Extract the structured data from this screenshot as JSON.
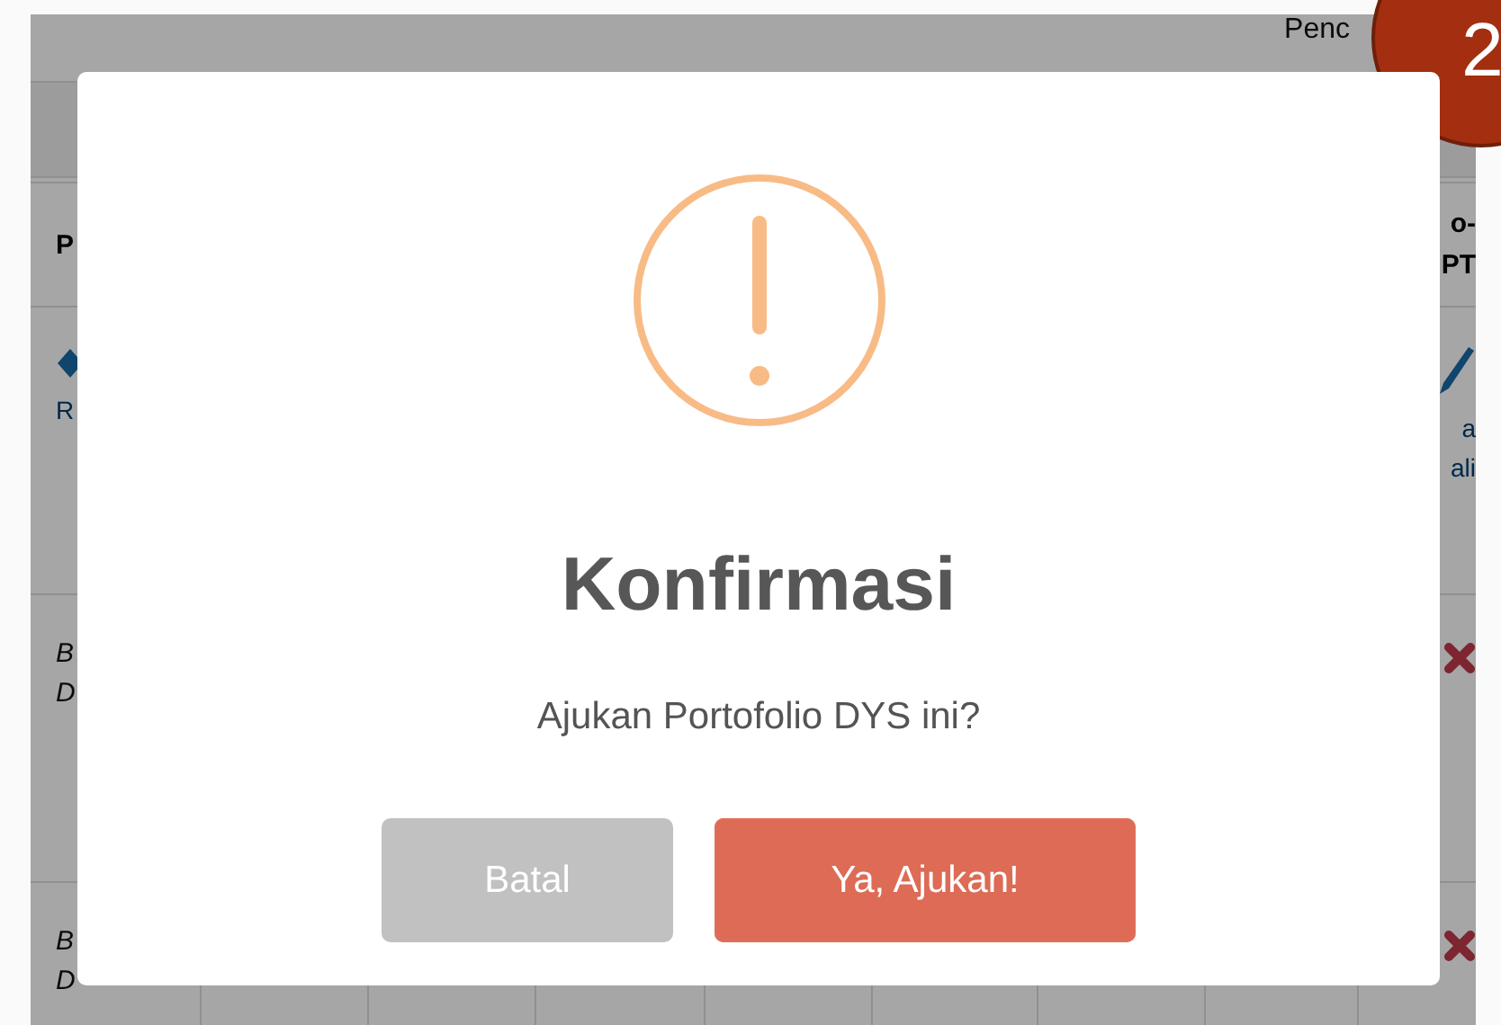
{
  "page": {
    "header_text": "Penc"
  },
  "notification_badge": {
    "count": "2"
  },
  "table": {
    "first_column_header": [
      "P"
    ],
    "last_column_header": [
      "o-",
      "PT"
    ],
    "rows": [
      {
        "kind": "editable",
        "first_cell": [
          "R"
        ],
        "last_cell": [
          "a",
          "ali"
        ]
      },
      {
        "kind": "deletable",
        "first_cell": [
          "B",
          "D"
        ]
      },
      {
        "kind": "deletable",
        "first_cell": [
          "B",
          "D"
        ]
      }
    ]
  },
  "dialog": {
    "title": "Konfirmasi",
    "message": "Ajukan Portofolio DYS ini?",
    "buttons": [
      {
        "label": "Batal",
        "kind": "cancel"
      },
      {
        "label": "Ya, Ajukan!",
        "kind": "confirm"
      }
    ]
  }
}
